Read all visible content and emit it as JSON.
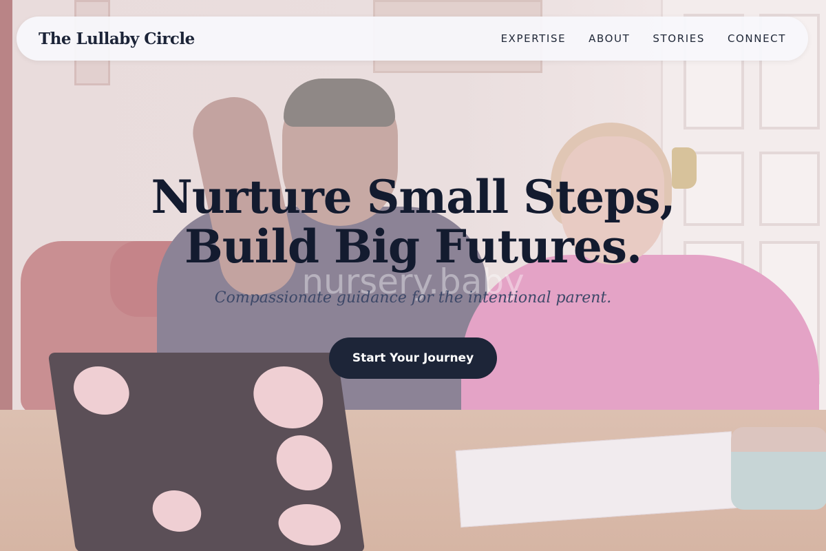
{
  "brand": {
    "name": "The Lullaby Circle"
  },
  "nav": {
    "items": [
      {
        "label": "EXPERTISE"
      },
      {
        "label": "ABOUT"
      },
      {
        "label": "STORIES"
      },
      {
        "label": "CONNECT"
      }
    ]
  },
  "hero": {
    "title_line1": "Nurture Small Steps,",
    "title_line2": "Build Big Futures.",
    "watermark": "nursery.baby",
    "tagline": "Compassionate guidance for the intentional parent.",
    "cta_label": "Start Your Journey"
  },
  "colors": {
    "nav_background": "#f8f8fc",
    "heading": "#131b2f",
    "cta_background": "#1d2538",
    "cta_text": "#ffffff",
    "tagline": "#3d4868"
  }
}
